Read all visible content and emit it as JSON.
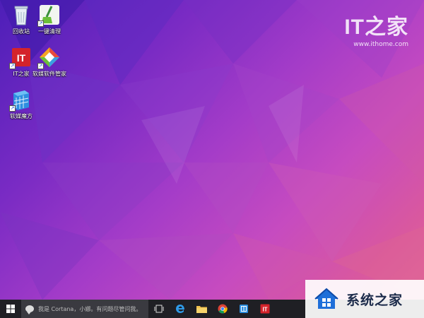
{
  "desktop": {
    "icons": [
      {
        "label": "回收站",
        "icon": "recycle-bin-icon"
      },
      {
        "label": "一键清理",
        "icon": "broom-clean-icon"
      },
      {
        "label": "IT之家",
        "icon": "ithome-icon"
      },
      {
        "label": "软媒软件管家",
        "icon": "software-manager-icon"
      },
      {
        "label": "软媒魔方",
        "icon": "cube-icon"
      }
    ]
  },
  "watermark": {
    "logo_text": "IT之家",
    "url": "www.ithome.com"
  },
  "taskbar": {
    "search_placeholder": "我是 Cortana，小娜。有问题尽管问我。"
  },
  "brand_badge": {
    "name": "系统之家"
  },
  "colors": {
    "taskbar": "#1f1f24",
    "accent_blue": "#1e90ff",
    "it_red": "#d4232b"
  }
}
